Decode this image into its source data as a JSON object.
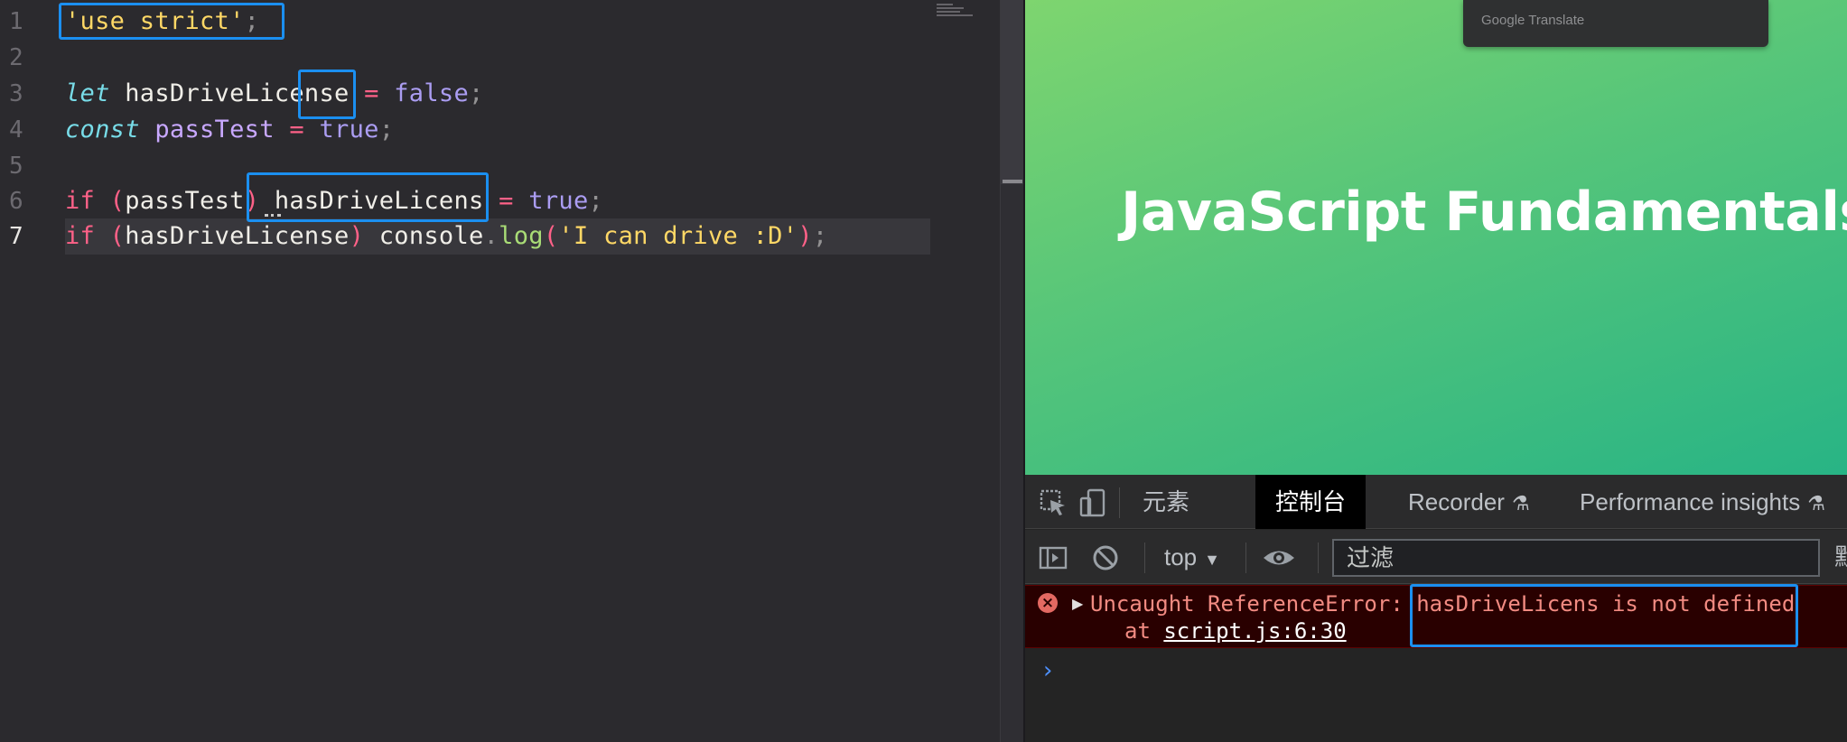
{
  "editor": {
    "line_numbers": [
      "1",
      "2",
      "3",
      "4",
      "5",
      "6",
      "7"
    ],
    "code": {
      "l1": {
        "str": "'use strict'",
        "semi": ";"
      },
      "l3": {
        "kw": "let",
        "ident": " hasDriveLicense",
        "op": " = ",
        "val": "false",
        "semi": ";"
      },
      "l4": {
        "kw": "const",
        "ident": " passTest",
        "op": " = ",
        "val": "true",
        "semi": ";"
      },
      "l6": {
        "kw": "if",
        "open": " (",
        "cond": "passTest",
        "close": ")",
        "ident": " hasDriveLicens",
        "op": " = ",
        "val": "true",
        "semi": ";"
      },
      "l7": {
        "kw": "if",
        "open": " (",
        "cond": "hasDriveLicense",
        "close": ")",
        "obj": " console",
        "dot": ".",
        "fn": "log",
        "paren_open": "(",
        "str": "'I can drive :D'",
        "paren_close": ")",
        "semi": ";"
      }
    }
  },
  "browser": {
    "popup_label": "Google Translate",
    "page_title": "JavaScript Fundamentals –"
  },
  "devtools": {
    "tabs": [
      "元素",
      "控制台",
      "Recorder",
      "Performance insights"
    ],
    "active_tab": "控制台",
    "context": "top",
    "filter_placeholder": "过滤",
    "toolbar_cutoff": "默",
    "error": {
      "prefix": "Uncaught ReferenceError: ",
      "message": "hasDriveLicens is not defined",
      "at": "at ",
      "location": "script.js:6:30"
    },
    "prompt": "›"
  },
  "colors": {
    "editor_bg": "#2b2a2e",
    "annotation_box": "#1b8ff0",
    "page_gradient_start": "#7ed56f",
    "page_gradient_end": "#28b485",
    "error_text": "#f28b82",
    "error_bg": "#290000"
  }
}
